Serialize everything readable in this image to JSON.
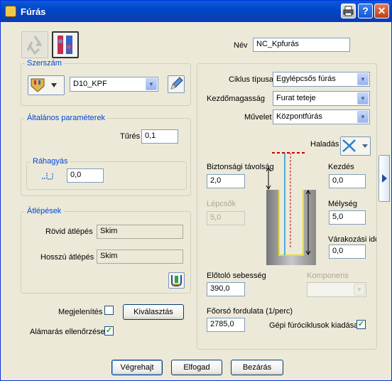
{
  "window": {
    "title": "Fúrás",
    "icon": "drill-icon"
  },
  "titlebar_buttons": {
    "print": "printer-icon",
    "help": "?",
    "close": "✕"
  },
  "name": {
    "label": "Név",
    "value": "NC_Kpfurás"
  },
  "tool": {
    "group": "Szerszám",
    "value": "D10_KPF"
  },
  "general": {
    "group": "Általános paraméterek",
    "tolerance_label": "Tűrés",
    "tolerance_value": "0,1",
    "allowance_group": "Ráhagyás",
    "allowance_value": "0,0"
  },
  "stepover": {
    "group": "Átlépések",
    "short_label": "Rövid átlépés",
    "short_value": "Skim",
    "long_label": "Hosszú átlépés",
    "long_value": "Skim"
  },
  "display": {
    "label": "Megjelenítés",
    "checked": false,
    "select_button": "Kiválasztás"
  },
  "gouge": {
    "label": "Alámarás ellenőrzése",
    "checked": true
  },
  "cycle": {
    "type_label": "Ciklus típusa",
    "type_value": "Egylépcsős fúrás",
    "start_height_label": "Kezdőmagasság",
    "start_height_value": "Furat teteje",
    "operation_label": "Művelet",
    "operation_value": "Központfúrás"
  },
  "progress": {
    "label": "Haladás"
  },
  "params": {
    "safety_label": "Biztonsági távolság",
    "safety_value": "2,0",
    "steps_label": "Lépcsők",
    "steps_value": "5,0",
    "start_label": "Kezdés",
    "start_value": "0,0",
    "depth_label": "Mélység",
    "depth_value": "5,0",
    "dwell_label": "Várakozási idő",
    "dwell_value": "0,0",
    "feed_label": "Előtoló sebesség",
    "feed_value": "390,0",
    "component_label": "Komponens",
    "component_value": "",
    "spindle_label": "Főorsó fordulata (1/perc)",
    "spindle_value": "2785,0",
    "machine_cycles_label": "Gépi fúróciklusok kiadása",
    "machine_cycles_checked": true
  },
  "footer": {
    "execute": "Végrehajt",
    "accept": "Elfogad",
    "close": "Bezárás"
  },
  "colors": {
    "title_bar": "#0a5bdc",
    "group_label": "#0046d5",
    "face": "#ece9d8"
  }
}
